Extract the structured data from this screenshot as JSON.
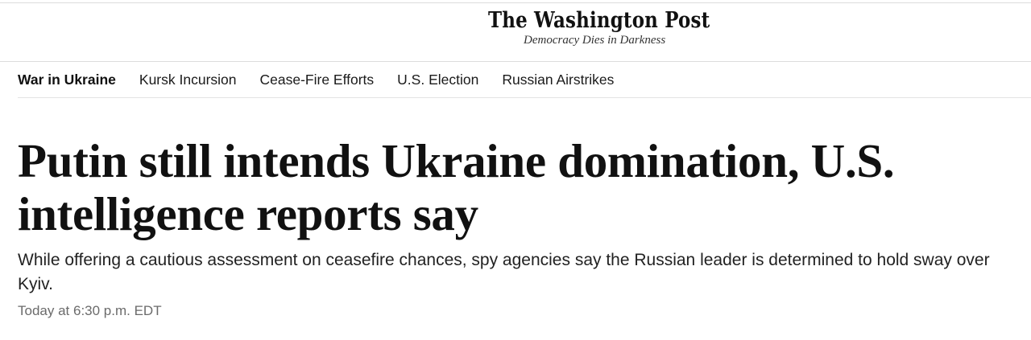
{
  "masthead": {
    "title": "The Washington Post",
    "tagline": "Democracy Dies in Darkness"
  },
  "nav": {
    "items": [
      {
        "label": "War in Ukraine"
      },
      {
        "label": "Kursk Incursion"
      },
      {
        "label": "Cease-Fire Efforts"
      },
      {
        "label": "U.S. Election"
      },
      {
        "label": "Russian Airstrikes"
      }
    ]
  },
  "article": {
    "headline": "Putin still intends Ukraine domination, U.S. intelligence reports say",
    "dek": "While offering a cautious assessment on ceasefire chances, spy agencies say the Russian leader is determined to hold sway over Kyiv.",
    "timestamp": "Today at 6:30 p.m. EDT"
  },
  "colors": {
    "text": "#111111",
    "muted": "#6b6b6b",
    "divider": "#dddddd"
  }
}
